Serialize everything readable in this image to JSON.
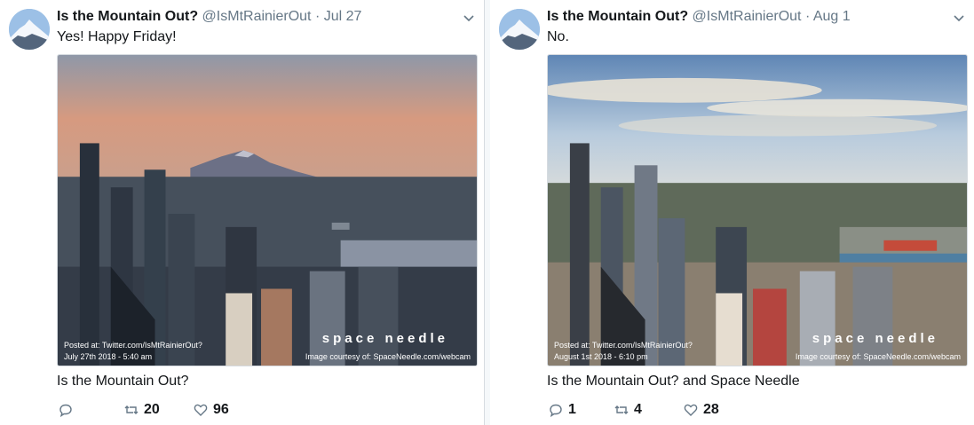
{
  "tweets": [
    {
      "name": "Is the Mountain Out?",
      "handle": "@IsMtRainierOut",
      "separator": "·",
      "date": "Jul 27",
      "text": "Yes! Happy Friday!",
      "image_caption_posted": "Posted at: Twitter.com/IsMtRainierOut?",
      "image_caption_date": "July 27th 2018 - 5:40 am",
      "image_brand": "space needle",
      "image_courtesy": "Image courtesy of: SpaceNeedle.com/webcam",
      "card_title": "Is the Mountain Out?",
      "reply_count": "",
      "retweet_count": "20",
      "like_count": "96"
    },
    {
      "name": "Is the Mountain Out?",
      "handle": "@IsMtRainierOut",
      "separator": "·",
      "date": "Aug 1",
      "text": "No.",
      "image_caption_posted": "Posted at: Twitter.com/IsMtRainierOut?",
      "image_caption_date": "August 1st 2018 - 6:10 pm",
      "image_brand": "space needle",
      "image_courtesy": "Image courtesy of: SpaceNeedle.com/webcam",
      "card_title": "Is the Mountain Out? and Space Needle",
      "reply_count": "1",
      "retweet_count": "4",
      "like_count": "28"
    }
  ],
  "icons": {
    "reply": "reply-icon",
    "retweet": "retweet-icon",
    "like": "heart-icon",
    "menu": "chevron-down-icon"
  },
  "colors": {
    "secondary_text": "#657786",
    "primary_text": "#14171a",
    "border": "#d6dbe0",
    "sky_sunrise": "#d69a80",
    "sky_day": "#9fbbd6"
  }
}
